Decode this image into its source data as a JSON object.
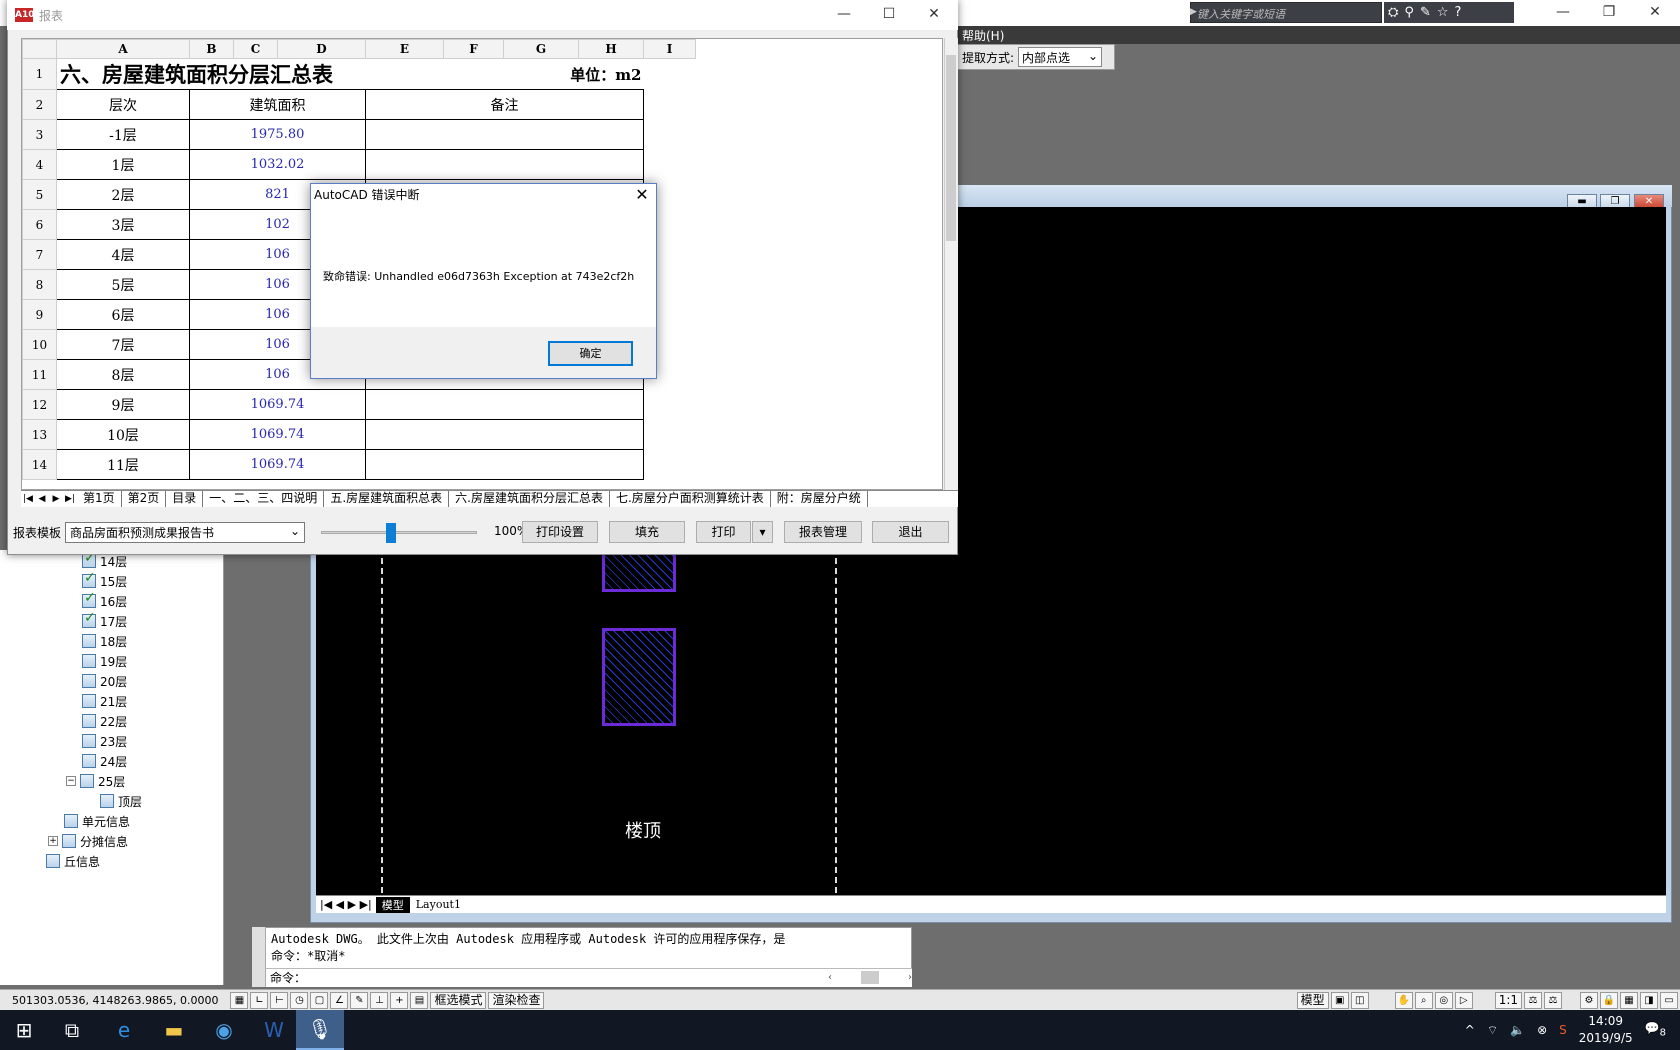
{
  "acad": {
    "search_placeholder": "键入关键字或短语",
    "menu_help": "帮助(H)",
    "extract_label": "提取方式:",
    "extract_value": "内部点选",
    "layout_tab_model": "模型",
    "layout_tab_layout1": "Layout1",
    "roof_label": "楼顶",
    "cmd_line1": "Autodesk DWG。  此文件上次由 Autodesk 应用程序或 Autodesk 许可的应用程序保存，是",
    "cmd_line2": "命令：*取消*",
    "cmd_prompt": "命令：",
    "coords": "501303.0536, 4148263.9865, 0.0000",
    "status_select_mode": "框选模式",
    "status_render_check": "渲染检查",
    "status_model": "模型",
    "status_scale": "1:1"
  },
  "tree": {
    "items": [
      {
        "label": "14层",
        "checked": true
      },
      {
        "label": "15层",
        "checked": true
      },
      {
        "label": "16层",
        "checked": true
      },
      {
        "label": "17层",
        "checked": true
      },
      {
        "label": "18层",
        "checked": false
      },
      {
        "label": "19层",
        "checked": false
      },
      {
        "label": "20层",
        "checked": false
      },
      {
        "label": "21层",
        "checked": false
      },
      {
        "label": "22层",
        "checked": false
      },
      {
        "label": "23层",
        "checked": false
      },
      {
        "label": "24层",
        "checked": false
      },
      {
        "label": "25层",
        "checked": false
      },
      {
        "label": "顶层",
        "checked": false
      },
      {
        "label": "单元信息",
        "checked": false
      },
      {
        "label": "分摊信息",
        "checked": false
      },
      {
        "label": "丘信息",
        "checked": false
      }
    ]
  },
  "report": {
    "window_title": "报表",
    "logo": "A10",
    "col_headers": [
      "A",
      "B",
      "C",
      "D",
      "E",
      "F",
      "G",
      "H",
      "I"
    ],
    "sheet_title": "六、房屋建筑面积分层汇总表",
    "unit": "单位：m2",
    "header_floor": "层次",
    "header_area": "建筑面积",
    "header_note": "备注",
    "rows": [
      {
        "num": "1"
      },
      {
        "num": "2"
      },
      {
        "num": "3",
        "floor": "-1层",
        "area": "1975.80"
      },
      {
        "num": "4",
        "floor": "1层",
        "area": "1032.02"
      },
      {
        "num": "5",
        "floor": "2层",
        "area": "821"
      },
      {
        "num": "6",
        "floor": "3层",
        "area": "102"
      },
      {
        "num": "7",
        "floor": "4层",
        "area": "106"
      },
      {
        "num": "8",
        "floor": "5层",
        "area": "106"
      },
      {
        "num": "9",
        "floor": "6层",
        "area": "106"
      },
      {
        "num": "10",
        "floor": "7层",
        "area": "106"
      },
      {
        "num": "11",
        "floor": "8层",
        "area": "106"
      },
      {
        "num": "12",
        "floor": "9层",
        "area": "1069.74"
      },
      {
        "num": "13",
        "floor": "10层",
        "area": "1069.74"
      },
      {
        "num": "14",
        "floor": "11层",
        "area": "1069.74"
      }
    ],
    "sheet_tabs": [
      "第1页",
      "第2页",
      "目录",
      "一、二、三、四说明",
      "五.房屋建筑面积总表",
      "六.房屋建筑面积分层汇总表",
      "七.房屋分户面积测算统计表",
      "附：房屋分户统"
    ],
    "active_tab": "六.房屋建筑面积分层汇总表",
    "template_label": "报表模板",
    "template_value": "商品房面积预测成果报告书",
    "zoom": "100%",
    "zoom_slider_fraction": 0.45,
    "btn_print_setup": "打印设置",
    "btn_fill": "填充",
    "btn_print": "打印",
    "btn_manage": "报表管理",
    "btn_exit": "退出"
  },
  "error_dialog": {
    "title": "AutoCAD 错误中断",
    "message": "致命错误:  Unhandled e06d7363h Exception at 743e2cf2h",
    "ok": "确定"
  },
  "taskbar": {
    "time": "14:09",
    "date": "2019/9/5",
    "notification_count": "8"
  }
}
